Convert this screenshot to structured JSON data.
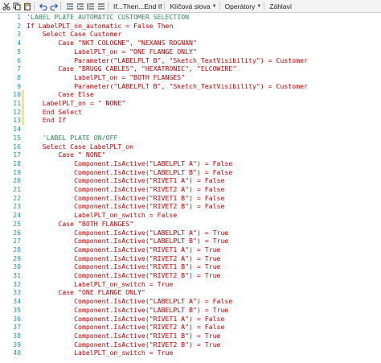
{
  "toolbar": {
    "menus": [
      {
        "label": "If...Then...End If",
        "name": "menu-if-then"
      },
      {
        "label": "Klíčová slova",
        "name": "menu-keywords"
      },
      {
        "label": "Operátory",
        "name": "menu-operators"
      },
      {
        "label": "Záhlaví",
        "name": "menu-headers"
      }
    ]
  },
  "editor": {
    "lines": [
      {
        "n": "1",
        "text": "'LABEL PLATE AUTOMATIC CUSTOMER SELECTION",
        "indent": 0,
        "comment": true,
        "mark": "none"
      },
      {
        "n": "2",
        "text": "If LabelPLT_on_automatic = False Then",
        "indent": 0,
        "comment": false,
        "mark": "none"
      },
      {
        "n": "3",
        "text": "Select Case Customer",
        "indent": 1,
        "comment": false,
        "mark": "none"
      },
      {
        "n": "4",
        "text": "Case \"NKT COLOGNE\", \"NEXANS ROGNAN\"",
        "indent": 2,
        "comment": false,
        "mark": "none"
      },
      {
        "n": "5",
        "text": "LabelPLT_on = \"ONE FLANGE ONLY\"",
        "indent": 3,
        "comment": false,
        "mark": "none"
      },
      {
        "n": "6",
        "text": "Parameter(\"LABELPLT B\", \"Sketch_TextVisibility\") = Customer",
        "indent": 3,
        "comment": false,
        "mark": "none"
      },
      {
        "n": "7",
        "text": "Case \"BRUGG CABLES\", \"HEXATRONIC\", \"ELCOWIRE\"",
        "indent": 2,
        "comment": false,
        "mark": "none"
      },
      {
        "n": "8",
        "text": "LabelPLT_on = \"BOTH FLANGES\"",
        "indent": 3,
        "comment": false,
        "mark": "none"
      },
      {
        "n": "9",
        "text": "Parameter(\"LABELPLT B\", \"Sketch_TextVisibility\") = Customer",
        "indent": 3,
        "comment": false,
        "mark": "none"
      },
      {
        "n": "10",
        "text": "Case Else",
        "indent": 2,
        "comment": false,
        "mark": "yellow"
      },
      {
        "n": "11",
        "text": "LabelPLT_on = \" NONE\"",
        "indent": 1,
        "comment": false,
        "mark": "yellow"
      },
      {
        "n": "12",
        "text": "End Select",
        "indent": 1,
        "comment": false,
        "mark": "yellow"
      },
      {
        "n": "13",
        "text": "End If",
        "indent": 1,
        "comment": false,
        "mark": "yellow"
      },
      {
        "n": "14",
        "text": "",
        "indent": 0,
        "comment": false,
        "mark": "none"
      },
      {
        "n": "15",
        "text": "'LABEL PLATE ON/OFF",
        "indent": 1,
        "comment": true,
        "mark": "none"
      },
      {
        "n": "16",
        "text": "Select Case LabelPLT_on",
        "indent": 1,
        "comment": false,
        "mark": "none"
      },
      {
        "n": "17",
        "text": "Case \" NONE\"",
        "indent": 2,
        "comment": false,
        "mark": "none"
      },
      {
        "n": "18",
        "text": "Component.IsActive(\"LABELPLT A\") = False",
        "indent": 3,
        "comment": false,
        "mark": "none"
      },
      {
        "n": "19",
        "text": "Component.IsActive(\"LABELPLT B\") = False",
        "indent": 3,
        "comment": false,
        "mark": "none"
      },
      {
        "n": "20",
        "text": "Component.IsActive(\"RIVET1 A\") = False",
        "indent": 3,
        "comment": false,
        "mark": "none"
      },
      {
        "n": "21",
        "text": "Component.IsActive(\"RIVET2 A\") = False",
        "indent": 3,
        "comment": false,
        "mark": "none"
      },
      {
        "n": "22",
        "text": "Component.IsActive(\"RIVET1 B\") = False",
        "indent": 3,
        "comment": false,
        "mark": "none"
      },
      {
        "n": "23",
        "text": "Component.IsActive(\"RIVET2 B\") = False",
        "indent": 3,
        "comment": false,
        "mark": "none"
      },
      {
        "n": "24",
        "text": "LabelPLT_on_switch = False",
        "indent": 3,
        "comment": false,
        "mark": "none"
      },
      {
        "n": "25",
        "text": "Case \"BOTH FLANGES\"",
        "indent": 2,
        "comment": false,
        "mark": "none"
      },
      {
        "n": "26",
        "text": "Component.IsActive(\"LABELPLT A\") = True",
        "indent": 3,
        "comment": false,
        "mark": "none"
      },
      {
        "n": "27",
        "text": "Component.IsActive(\"LABELPLT B\") = True",
        "indent": 3,
        "comment": false,
        "mark": "none"
      },
      {
        "n": "28",
        "text": "Component.IsActive(\"RIVET1 A\") = True",
        "indent": 3,
        "comment": false,
        "mark": "none"
      },
      {
        "n": "29",
        "text": "Component.IsActive(\"RIVET2 A\") = True",
        "indent": 3,
        "comment": false,
        "mark": "none"
      },
      {
        "n": "30",
        "text": "Component.IsActive(\"RIVET1 B\") = True",
        "indent": 3,
        "comment": false,
        "mark": "none"
      },
      {
        "n": "31",
        "text": "Component.IsActive(\"RIVET2 B\") = True",
        "indent": 3,
        "comment": false,
        "mark": "none"
      },
      {
        "n": "32",
        "text": "LabelPLT_on_switch = True",
        "indent": 3,
        "comment": false,
        "mark": "none"
      },
      {
        "n": "33",
        "text": "Case \"ONE FLANGE ONLY\"",
        "indent": 2,
        "comment": false,
        "mark": "none"
      },
      {
        "n": "34",
        "text": "Component.IsActive(\"LABELPLT A\") = False",
        "indent": 3,
        "comment": false,
        "mark": "none"
      },
      {
        "n": "35",
        "text": "Component.IsActive(\"LABELPLT B\") = True",
        "indent": 3,
        "comment": false,
        "mark": "none"
      },
      {
        "n": "36",
        "text": "Component.IsActive(\"RIVET1 A\") = False",
        "indent": 3,
        "comment": false,
        "mark": "none"
      },
      {
        "n": "37",
        "text": "Component.IsActive(\"RIVET2 A\") = False",
        "indent": 3,
        "comment": false,
        "mark": "none"
      },
      {
        "n": "38",
        "text": "Component.IsActive(\"RIVET1 B\") = True",
        "indent": 3,
        "comment": false,
        "mark": "none"
      },
      {
        "n": "39",
        "text": "Component.IsActive(\"RIVET2 B\") = True",
        "indent": 3,
        "comment": false,
        "mark": "none"
      },
      {
        "n": "40",
        "text": "LabelPLT_on_switch = True",
        "indent": 3,
        "comment": false,
        "mark": "none"
      }
    ]
  }
}
